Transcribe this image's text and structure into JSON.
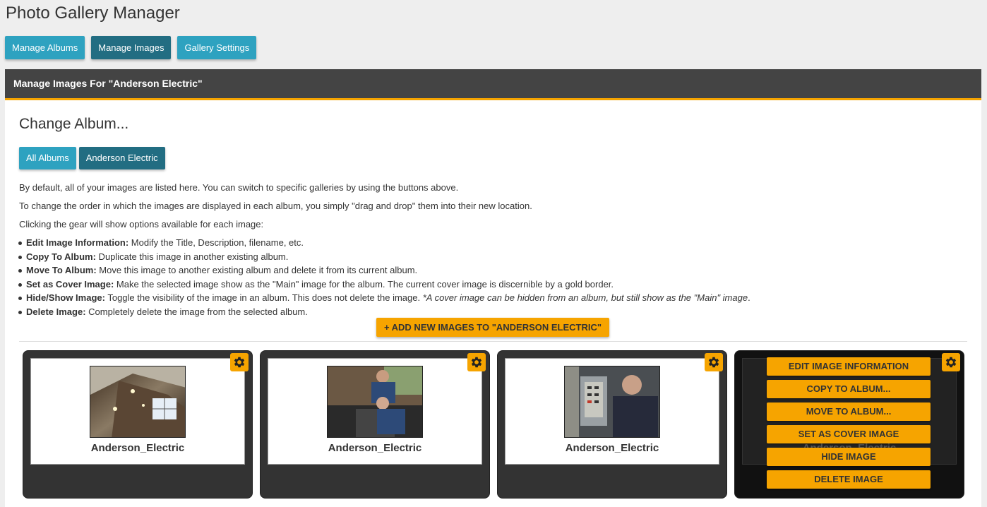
{
  "app": {
    "title": "Photo Gallery Manager"
  },
  "nav": [
    {
      "label": "Manage Albums"
    },
    {
      "label": "Manage Images"
    },
    {
      "label": "Gallery Settings"
    }
  ],
  "panel": {
    "header": "Manage Images For \"Anderson Electric\""
  },
  "change_album": {
    "heading": "Change Album...",
    "buttons": [
      {
        "label": "All Albums"
      },
      {
        "label": "Anderson Electric"
      }
    ]
  },
  "instructions": {
    "p1": "By default, all of your images are listed here. You can switch to specific galleries by using the buttons above.",
    "p2": "To change the order in which the images are displayed in each album, you simply \"drag and drop\" them into their new location.",
    "p3": "Clicking the gear will show options available for each image:",
    "features": [
      {
        "term": "Edit Image Information:",
        "desc": " Modify the Title, Description, filename, etc."
      },
      {
        "term": "Copy To Album:",
        "desc": " Duplicate this image in another existing album."
      },
      {
        "term": "Move To Album:",
        "desc": " Move this image to another existing album and delete it from its current album."
      },
      {
        "term": "Set as Cover Image:",
        "desc": " Make the selected image show as the \"Main\" image for the album. The current cover image is discernible by a gold border."
      },
      {
        "term": "Hide/Show Image:",
        "desc": " Toggle the visibility of the image in an album. This does not delete the image. ",
        "note": "*A cover image can be hidden from an album, but still show as the \"Main\" image",
        "end": "."
      },
      {
        "term": "Delete Image:",
        "desc": " Completely delete the image from the selected album."
      }
    ]
  },
  "add_button": {
    "label": "+ ADD NEW IMAGES TO \"ANDERSON ELECTRIC\""
  },
  "images": [
    {
      "title": "Anderson_Electric",
      "icon": "gear-icon"
    },
    {
      "title": "Anderson_Electric",
      "icon": "gear-icon"
    },
    {
      "title": "Anderson_Electric",
      "icon": "gear-icon"
    },
    {
      "title": "Anderson_Electric",
      "icon": "gear-icon"
    }
  ],
  "image_menu": [
    {
      "label": "EDIT IMAGE INFORMATION"
    },
    {
      "label": "COPY TO ALBUM..."
    },
    {
      "label": "MOVE TO ALBUM..."
    },
    {
      "label": "SET AS COVER IMAGE"
    },
    {
      "label": "HIDE IMAGE"
    },
    {
      "label": "DELETE IMAGE"
    }
  ],
  "colors": {
    "accent": "#f6a400",
    "button_light": "#2ea2c0",
    "button_dark": "#226d82",
    "header": "#444444",
    "card": "#333333"
  }
}
